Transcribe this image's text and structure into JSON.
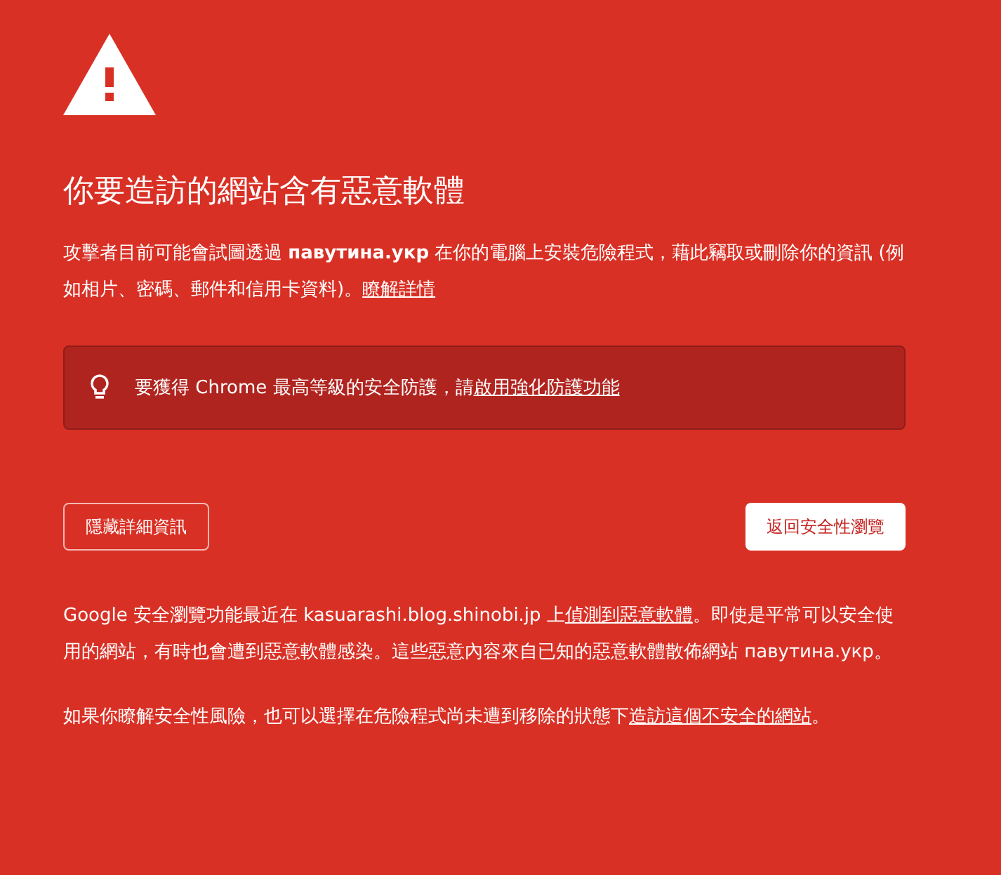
{
  "heading": "你要造訪的網站含有惡意軟體",
  "intro": {
    "before": "攻擊者目前可能會試圖透過 **павутина.укр** 在你的電腦上安裝危險程式，藉此竊取或刪除你的資訊 (例如相片、密碼、郵件和信用卡資料)。",
    "link": "瞭解詳情"
  },
  "protection_banner": {
    "before": "要獲得 Chrome 最高等級的安全防護，請",
    "link": "啟用強化防護功能"
  },
  "buttons": [
    {
      "kind": "details",
      "label": "隱藏詳細資訊"
    },
    {
      "kind": "primary",
      "label": "返回安全性瀏覽"
    }
  ],
  "details": [
    {
      "before": "Google 安全瀏覽功能最近在 kasuarashi.blog.shinobi.jp 上",
      "link": "偵測到惡意軟體",
      "after": "。即使是平常可以安全使用的網站，有時也會遭到惡意軟體感染。這些惡意內容來自已知的惡意軟體散佈網站 павутина.укр。"
    },
    {
      "before": "如果你瞭解安全性風險，也可以選擇在危險程式尚未遭到移除的狀態下",
      "link": "造訪這個不安全的網站",
      "after": "。"
    }
  ]
}
